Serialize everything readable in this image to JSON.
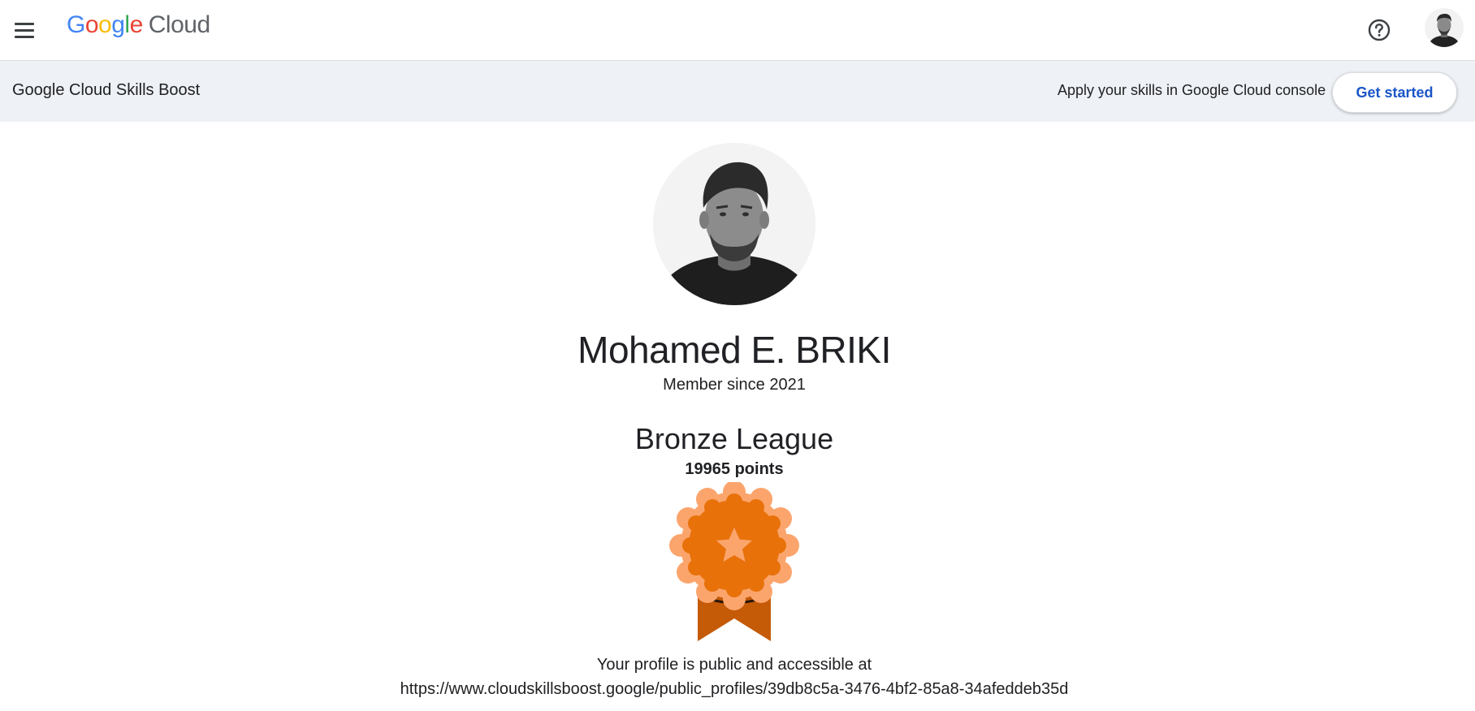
{
  "header": {
    "logo_text": {
      "g": "G",
      "o1": "o",
      "o2": "o",
      "g2": "g",
      "l": "l",
      "e": "e",
      "cloud": "Cloud"
    },
    "menu_icon": "hamburger-menu-icon",
    "help_icon": "help-circle-icon",
    "account_icon": "user-avatar"
  },
  "subheader": {
    "product_name": "Google Cloud Skills Boost",
    "apply_text": "Apply your skills in Google Cloud console",
    "cta_label": "Get started"
  },
  "profile": {
    "name": "Mohamed E. BRIKI",
    "member_since": "Member since 2021",
    "league": "Bronze League",
    "points": "19965 points",
    "badge_icon": "bronze-league-badge-icon",
    "public_note": "Your profile is public and accessible at",
    "public_url": "https://www.cloudskillsboost.google/public_profiles/39db8c5a-3476-4bf2-85a8-34afeddeb35d"
  },
  "colors": {
    "accent_blue": "#1a56c8",
    "subbar_bg": "#eef1f5",
    "badge_orange": "#e8710a",
    "badge_light": "#fba56d",
    "ribbon": "#c55a07"
  }
}
